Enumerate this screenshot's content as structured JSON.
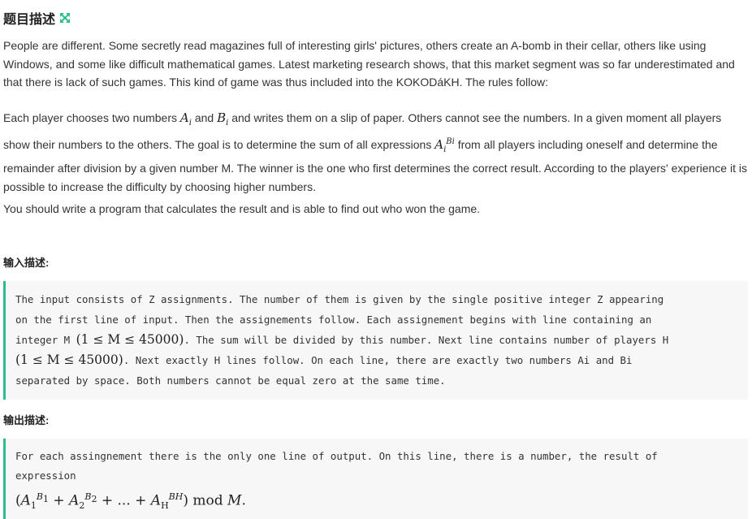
{
  "problem": {
    "title": "题目描述",
    "expand_icon": "expand-arrows-icon",
    "accent_color": "#2dbb8f",
    "paragraph1": "People are different. Some secretly read magazines full of interesting girls' pictures, others create an A-bomb in their cellar, others like using Windows, and some like difficult mathematical games. Latest marketing research shows, that this market segment was so far underestimated and that there is lack of such games. This kind of game was thus included into the KOKODáKH. The rules follow:",
    "paragraph2": {
      "part1": "Each player chooses two numbers ",
      "a_i": "A",
      "sub_i": "i",
      "and": " and ",
      "b_i": "B",
      "part2": " and writes them on a slip of paper. Others cannot see the numbers. In a given moment all players show their numbers to the others. The goal is to determine the sum of all expressions ",
      "expr_base": "A",
      "expr_sub": "i",
      "expr_sup": "Bi",
      "part3": " from all players including oneself and determine the remainder after division by a given number M. The winner is the one who first determines the correct result. According to the players' experience it is possible to increase the difficulty by choosing higher numbers."
    },
    "paragraph3": "You should write a program that calculates the result and is able to find out who won the game."
  },
  "input": {
    "title": "输入描述:",
    "line1": "The input consists of Z assignments. The number of them is given by the single positive integer Z appearing",
    "line2": "on the first line of input. Then the assignements follow. Each assignement begins with line containing an",
    "line3_pre": "integer M ",
    "range1": "(1 ≤ M ≤ 45000)",
    "line3_post": ". The sum will be divided by this number. Next line contains number of players H",
    "range2": "(1 ≤ M ≤ 45000)",
    "line4_post": ". Next exactly H lines follow. On each line, there are exactly two numbers Ai and Bi",
    "line5": "separated by space. Both numbers cannot be equal zero at the same time."
  },
  "output": {
    "title": "输出描述:",
    "line1": "For each assingnement there is the only one line of output. On this line, there is a number, the result of",
    "line2": "expression",
    "formula": {
      "open": "(",
      "a1": "A",
      "a1_sub": "1",
      "a1_sup_base": "B",
      "a1_sup_sub": "1",
      "plus1": " + ",
      "a2": "A",
      "a2_sub": "2",
      "a2_sup_base": "B",
      "a2_sup_sub": "2",
      "plus2": " + ... + ",
      "ah": "A",
      "ah_sub": "H",
      "ah_sup": "BH",
      "close": ")",
      "mod": " mod ",
      "m": "M",
      "dot": "."
    }
  }
}
